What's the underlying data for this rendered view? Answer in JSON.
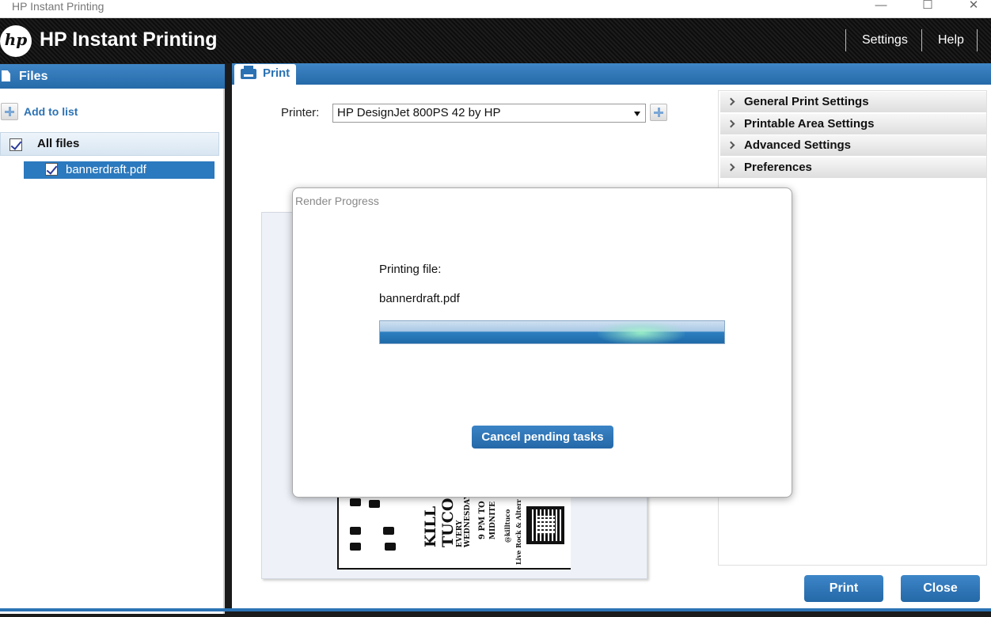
{
  "window": {
    "title": "HP Instant Printing",
    "min_glyph": "—",
    "max_glyph": "☐",
    "close_glyph": "✕"
  },
  "header": {
    "logo_text": "hp",
    "app_title": "HP Instant Printing",
    "nav": [
      {
        "label": "Settings"
      },
      {
        "label": "Help"
      }
    ]
  },
  "files": {
    "title": "Files",
    "add_label": "Add to list",
    "all_files_label": "All files",
    "items": [
      {
        "name": "bannerdraft.pdf",
        "checked": true
      }
    ]
  },
  "print": {
    "tab_label": "Print",
    "printer_label": "Printer:",
    "printer_value": "HP DesignJet 800PS 42 by HP",
    "sections": [
      {
        "label": "General Print Settings"
      },
      {
        "label": "Printable Area Settings"
      },
      {
        "label": "Advanced Settings"
      },
      {
        "label": "Preferences"
      }
    ],
    "print_button": "Print",
    "close_button": "Close"
  },
  "poster": {
    "line1": "KILL",
    "line1b": "TUCO",
    "line2": "EVERY",
    "line3": "WEDNESDAY",
    "line4": "9 PM TO",
    "line5": "MIDNITE",
    "line6": "@killtuco",
    "line7": "Live Rock & Alterr"
  },
  "dialog": {
    "title": "Render Progress",
    "label": "Printing file:",
    "file": "bannerdraft.pdf",
    "progress_fraction": 0.9,
    "cancel_label": "Cancel pending tasks"
  },
  "colors": {
    "accent": "#2b72b4",
    "header_bg": "#151515",
    "selection": "#2b79be"
  }
}
